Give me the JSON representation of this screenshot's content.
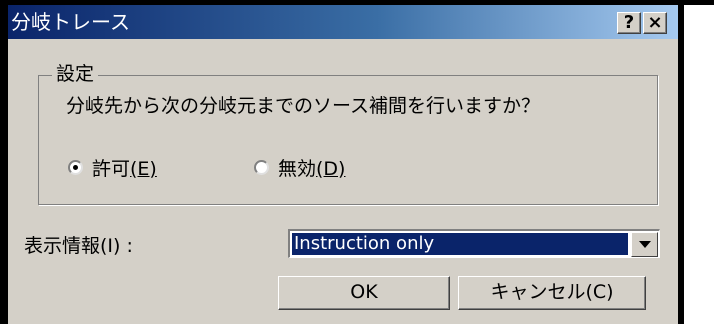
{
  "dialog": {
    "title": "分岐トレース",
    "help_button": "?",
    "close_button": "×"
  },
  "settings": {
    "group_label": "設定",
    "prompt": "分岐先から次の分岐元までのソース補間を行いますか？",
    "options": [
      {
        "label": "許可",
        "access_key": "(E)",
        "selected": true
      },
      {
        "label": "無効",
        "access_key": "(D)",
        "selected": false
      }
    ]
  },
  "display_info": {
    "label": "表示情報(I) :",
    "selected_value": "Instruction only"
  },
  "buttons": {
    "ok": "OK",
    "cancel": "キャンセル(C)"
  },
  "colors": {
    "title_bar_start": "#0a246a",
    "title_bar_end": "#a6caf0",
    "face": "#d4d0c8",
    "selection": "#0a246a"
  },
  "icons": {
    "dropdown": "chevron-down-icon",
    "help": "question-icon",
    "close": "close-icon"
  }
}
